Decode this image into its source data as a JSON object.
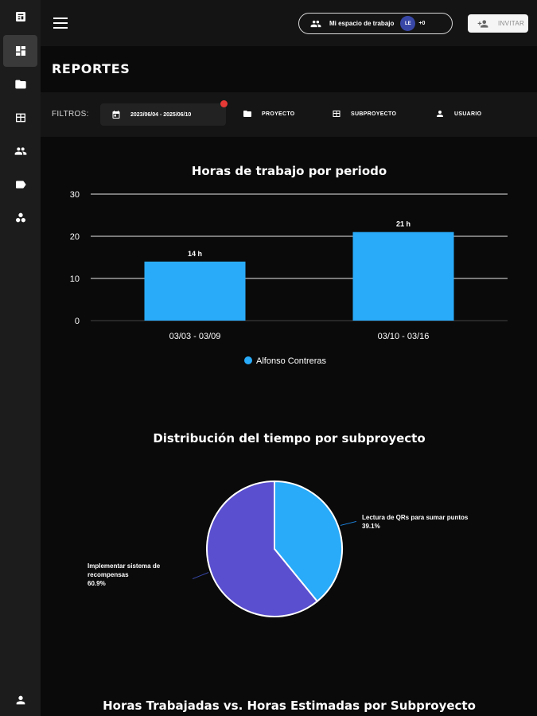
{
  "sidebar": {
    "items": [
      {
        "icon": "report-icon",
        "active": false
      },
      {
        "icon": "dashboard-icon",
        "active": true
      },
      {
        "icon": "folder-icon",
        "active": false
      },
      {
        "icon": "table-icon",
        "active": false
      },
      {
        "icon": "group-icon",
        "active": false
      },
      {
        "icon": "tag-icon",
        "active": false
      },
      {
        "icon": "bubble-chart-icon",
        "active": false
      }
    ],
    "bottom_icon": "user-icon"
  },
  "header": {
    "workspace_label": "Mi espacio de trabajo",
    "avatar_initials": "LE",
    "member_count": "+0",
    "invite_label": "INVITAR"
  },
  "page": {
    "title": "REPORTES"
  },
  "filters": {
    "label": "FILTROS:",
    "date_range": "2023/06/04 - 2025/06/10",
    "project": "PROYECTO",
    "subproject": "SUBPROYECTO",
    "user": "USUARIO"
  },
  "colors": {
    "bar": "#29abf9",
    "pie_a": "#29abf9",
    "pie_b": "#5a4fcf",
    "active_filter_dot": "#e53935"
  },
  "chart_data": [
    {
      "type": "bar",
      "title": "Horas de trabajo por periodo",
      "categories": [
        "03/03 - 03/09",
        "03/10 - 03/16"
      ],
      "series": [
        {
          "name": "Alfonso Contreras",
          "values": [
            14,
            21
          ]
        }
      ],
      "data_labels": [
        "14 h",
        "21 h"
      ],
      "ylim": [
        0,
        30
      ],
      "yticks": [
        0,
        10,
        20,
        30
      ],
      "grid": true,
      "legend": "bottom"
    },
    {
      "type": "pie",
      "title": "Distribución del tiempo por subproyecto",
      "slices": [
        {
          "label": "Lectura de QRs para sumar puntos",
          "value": 39.1,
          "pct_label": "39.1%"
        },
        {
          "label": "Implementar sistema de recompensas",
          "value": 60.9,
          "pct_label": "60.9%"
        }
      ]
    },
    {
      "type": "bar",
      "title": "Horas Trabajadas vs. Horas Estimadas por Subproyecto"
    }
  ]
}
